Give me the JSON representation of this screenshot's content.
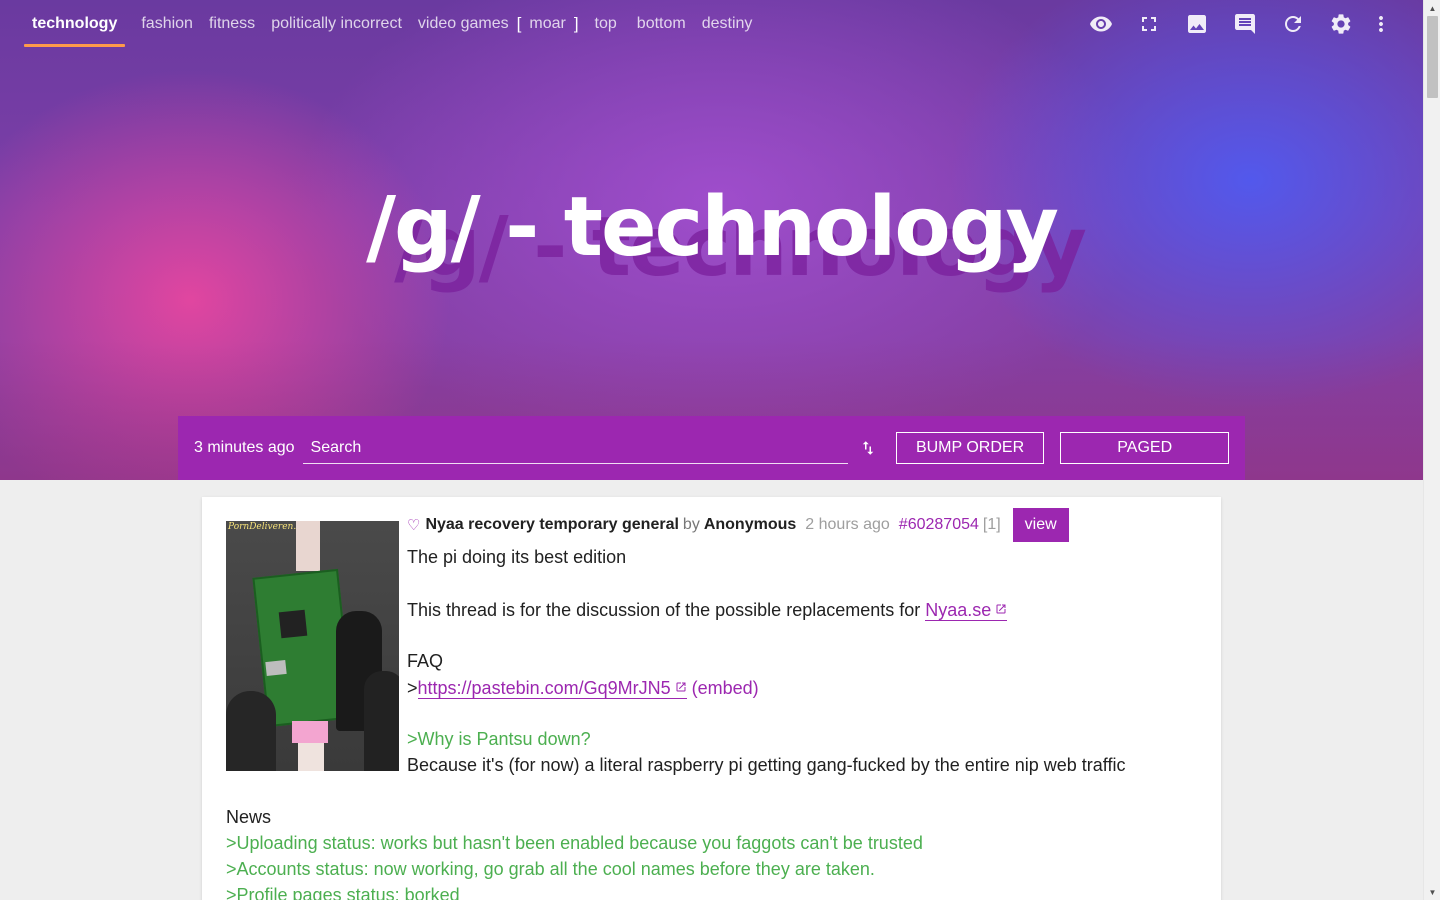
{
  "nav": {
    "boards": [
      {
        "label": "technology",
        "active": true
      },
      {
        "label": "fashion"
      },
      {
        "label": "fitness"
      },
      {
        "label": "politically incorrect"
      },
      {
        "label": "video games"
      }
    ],
    "bracket_open": "[",
    "more_label": "moar",
    "bracket_close": "]",
    "sort_links": [
      "top",
      "bottom",
      "destiny"
    ]
  },
  "toolbar": {
    "icons": [
      "eye-icon",
      "fullscreen-icon",
      "image-icon",
      "comment-icon",
      "refresh-icon",
      "settings-icon",
      "more-vert-icon"
    ]
  },
  "hero": {
    "title": "/g/ - technology"
  },
  "controls": {
    "updated": "3 minutes ago",
    "search_placeholder": "Search",
    "sort_button": "BUMP ORDER",
    "mode_button": "PAGED"
  },
  "post": {
    "subject": "Nyaa recovery temporary general",
    "by": "by",
    "author": "Anonymous",
    "time_ago": "2 hours ago",
    "post_number": "#60287054",
    "reply_count": "[1]",
    "view_label": "view",
    "thumbnail_watermark": "PornDeliveren.Com",
    "body": {
      "edition": "The pi doing its best edition",
      "intro_text": "This thread is for the discussion of the possible replacements for ",
      "intro_link": "Nyaa.se",
      "faq": "FAQ",
      "faq_prefix": ">",
      "faq_link": "https://pastebin.com/Gq9MrJN5",
      "embed": "(embed)",
      "quote1": ">Why is Pantsu down?",
      "answer1": "Because it's (for now) a literal raspberry pi getting gang-fucked by the entire nip web traffic",
      "news": "News",
      "news_items": [
        ">Uploading status: works but hasn't been enabled because you faggots can't be trusted",
        ">Accounts status: now working, go grab all the cool names before they are taken.",
        ">Profile pages status: borked"
      ]
    }
  },
  "colors": {
    "accent": "#9c27b0",
    "quote_green": "#4caf50",
    "nav_underline": "#ff9a4a"
  }
}
